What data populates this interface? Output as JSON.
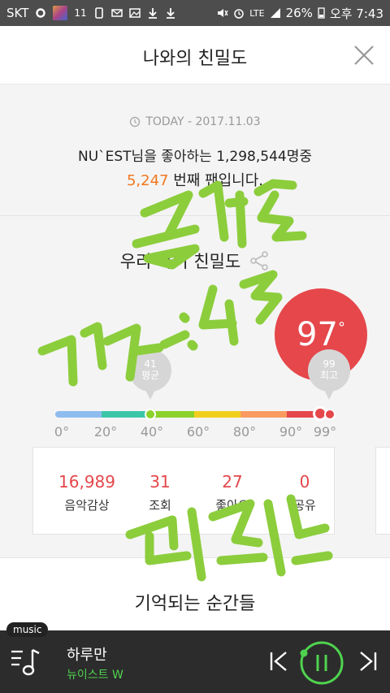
{
  "status_bar": {
    "carrier": "SKT",
    "notification_text": "11",
    "network": "LTE",
    "battery": "26%",
    "time": "오후 7:43"
  },
  "header": {
    "title": "나와의 친밀도",
    "close_icon": "close-icon"
  },
  "today": {
    "label": "TODAY - 2017.11.03"
  },
  "fan_info": {
    "line1": "NU`EST님을 좋아하는 1,298,544명중",
    "rank": "5,247",
    "line2_suffix": " 번째 팬입니다."
  },
  "intimacy": {
    "title": "우리 사이 친밀도",
    "score": "97",
    "score_unit": "°",
    "average_value": "41",
    "average_label": "평균",
    "max_value": "99",
    "max_label": "최고",
    "scale_ticks": [
      "0°",
      "20°",
      "40°",
      "60°",
      "80°",
      "90°",
      "99°"
    ],
    "bar_colors": [
      "#8fbcef",
      "#3cc6a8",
      "#8cd22a",
      "#f2cf1c",
      "#f99a5f",
      "#e5474b"
    ]
  },
  "stats": [
    {
      "value": "16,989",
      "label": "음악감상"
    },
    {
      "value": "31",
      "label": "조회"
    },
    {
      "value": "27",
      "label": "좋아요"
    },
    {
      "value": "0",
      "label": "공유"
    }
  ],
  "memory": {
    "title": "기억되는 순간들"
  },
  "player": {
    "tag": "music",
    "song": "하루만",
    "artist": "뉴이스트 W"
  },
  "colors": {
    "accent_red": "#e5474b",
    "accent_orange": "#f07820",
    "player_green": "#4fd34f"
  }
}
